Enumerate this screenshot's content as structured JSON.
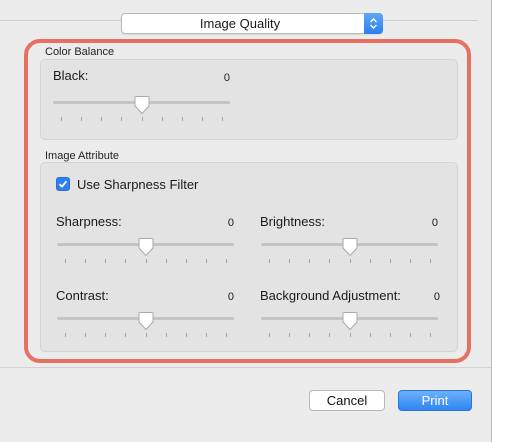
{
  "popup": {
    "selected": "Image Quality",
    "stepper_icon": "up-down-arrows-icon"
  },
  "color_balance": {
    "caption": "Color Balance",
    "black": {
      "label": "Black:",
      "value": "0",
      "level": 0.5,
      "tick_count": 9
    }
  },
  "image_attribute": {
    "caption": "Image Attribute",
    "sharpness_filter": {
      "label": "Use Sharpness Filter",
      "checked": true
    },
    "sharpness": {
      "label": "Sharpness:",
      "value": "0",
      "level": 0.5,
      "tick_count": 9
    },
    "brightness": {
      "label": "Brightness:",
      "value": "0",
      "level": 0.5,
      "tick_count": 9
    },
    "contrast": {
      "label": "Contrast:",
      "value": "0",
      "level": 0.5,
      "tick_count": 9
    },
    "background_adjustment": {
      "label": "Background Adjustment:",
      "value": "0",
      "level": 0.5,
      "tick_count": 9
    }
  },
  "buttons": {
    "cancel": "Cancel",
    "print": "Print"
  },
  "colors": {
    "highlight": "#e87063",
    "accent": "#2f84f1",
    "panel": "#e3e3e3",
    "background": "#ececec"
  }
}
